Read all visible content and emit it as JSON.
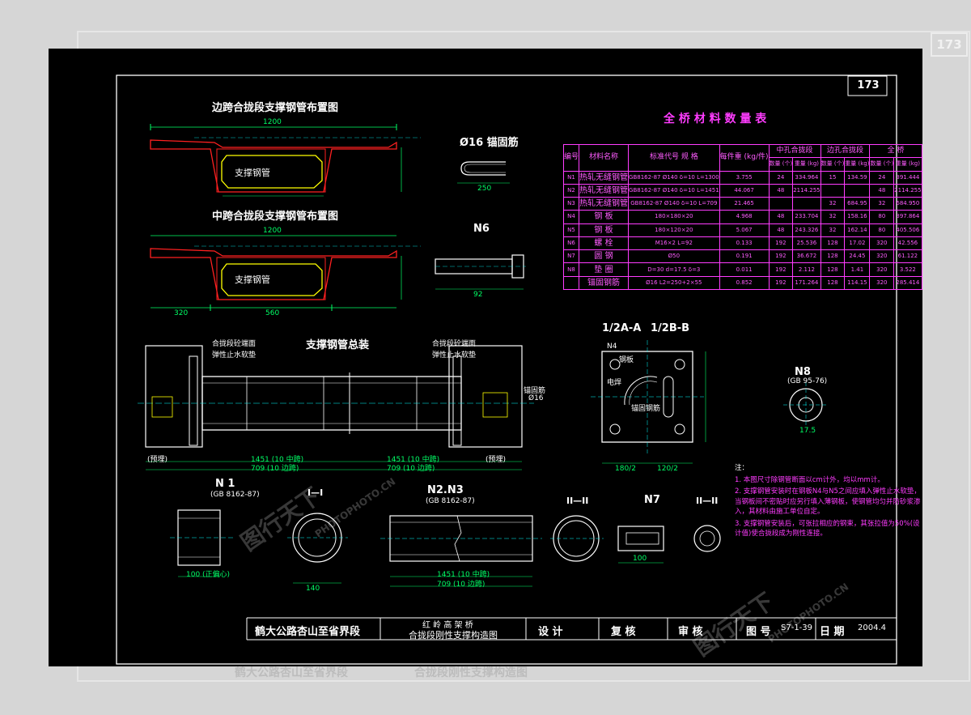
{
  "sheet_number": "173",
  "titles": {
    "side_span": "边跨合拢段支撑钢管布置图",
    "mid_span": "中跨合拢段支撑钢管布置图",
    "anchor_bar": "Ø16 锚固筋",
    "n6": "N6",
    "assembly": "支撑钢管总装",
    "section_aa": "1/2A-A",
    "section_bb": "1/2B-B",
    "n8": "N8",
    "n8_std": "(GB 95-76)",
    "n1": "N 1",
    "n1_std": "(GB 8162-87)",
    "sec_1": "I—I",
    "n2n3": "N2.N3",
    "n2n3_std": "(GB 8162-87)",
    "sec_2": "II—II",
    "n7": "N7",
    "sec_2b": "II—II"
  },
  "labels": {
    "steel_pipe": "支撑钢管",
    "end_face_left": "合拢段砼端面",
    "waterstop_left": "弹性止水软垫",
    "end_face_right": "合拢段砼端面",
    "waterstop_right": "弹性止水软垫",
    "anchor": "锚固筋",
    "anchor_dia": "Ø16",
    "weld_left": "(预埋)",
    "weld_right": "(预埋)",
    "plate_label_1": "钢板",
    "plate_label_2": "锚固钢筋",
    "plate_label_3": "电焊",
    "plate_label_4": "N4"
  },
  "dims": {
    "top_1": "1200",
    "side_320": "320",
    "mid_560": "560",
    "mid_1200": "1200",
    "n6_len": "92",
    "anchor_len": "250",
    "asm_1": "1451 (10 中跨)",
    "asm_2": "709 (10 边跨)",
    "n1_len": "100 (正偏心)",
    "n1_140": "140",
    "n2_1": "1451 (10 中跨)",
    "n2_2": "709 (10 边跨)",
    "n7_len": "100",
    "n8_d": "17.5",
    "plate_180": "180/2",
    "plate_120": "120/2"
  },
  "material_table": {
    "title": "全 桥 材 料 数 量 表",
    "headers": {
      "no": "编号",
      "name": "材料名称",
      "spec": "标准代号 规 格",
      "unit_wt": "每件重 (kg/件)",
      "mid": "中孔合拢段",
      "side": "边孔合拢段",
      "total": "全 桥",
      "count": "数量 (个)",
      "weight": "重量 (kg)"
    },
    "rows": [
      {
        "no": "N1",
        "name": "热轧无缝钢管",
        "spec": "GB8162-87  Ø140 δ=10  L=1300",
        "uw": "3.755",
        "mc": "24",
        "mw": "334.964",
        "sc": "15",
        "sw": "134.59",
        "tc": "24",
        "tw": "391.444"
      },
      {
        "no": "N2",
        "name": "热轧无缝钢管",
        "spec": "GB8162-87  Ø140 δ=10  L=1451",
        "uw": "44.067",
        "mc": "48",
        "mw": "2114.255",
        "sc": "",
        "sw": "",
        "tc": "48",
        "tw": "2114.255"
      },
      {
        "no": "N3",
        "name": "热轧无缝钢管",
        "spec": "GB8162-87  Ø140 δ=10  L=709",
        "uw": "21.465",
        "mc": "",
        "mw": "",
        "sc": "32",
        "sw": "684.95",
        "tc": "32",
        "tw": "684.950"
      },
      {
        "no": "N4",
        "name": "钢 板",
        "spec": "180×180×20",
        "uw": "4.968",
        "mc": "48",
        "mw": "233.704",
        "sc": "32",
        "sw": "158.16",
        "tc": "80",
        "tw": "397.864"
      },
      {
        "no": "N5",
        "name": "钢 板",
        "spec": "180×120×20",
        "uw": "5.067",
        "mc": "48",
        "mw": "243.326",
        "sc": "32",
        "sw": "162.14",
        "tc": "80",
        "tw": "405.506"
      },
      {
        "no": "N6",
        "name": "螺 栓",
        "spec": "M16×2  L=92",
        "uw": "0.133",
        "mc": "192",
        "mw": "25.536",
        "sc": "128",
        "sw": "17.02",
        "tc": "320",
        "tw": "42.556"
      },
      {
        "no": "N7",
        "name": "圆 钢",
        "spec": "Ø50",
        "uw": "0.191",
        "mc": "192",
        "mw": "36.672",
        "sc": "128",
        "sw": "24.45",
        "tc": "320",
        "tw": "61.122"
      },
      {
        "no": "N8",
        "name": "垫 圈",
        "spec": "D=30 d=17.5 δ=3",
        "uw": "0.011",
        "mc": "192",
        "mw": "2.112",
        "sc": "128",
        "sw": "1.41",
        "tc": "320",
        "tw": "3.522"
      },
      {
        "no": "",
        "name": "锚固钢筋",
        "spec": "Ø16  L2=250+2×55",
        "uw": "0.852",
        "mc": "192",
        "mw": "171.264",
        "sc": "128",
        "sw": "114.15",
        "tc": "320",
        "tw": "285.414"
      }
    ]
  },
  "notes": {
    "heading": "注：",
    "items": [
      "1. 本图尺寸除钢管断面以cm计外，均以mm计。",
      "2. 支撑钢管安装时在钢板N4与N5之间应填入弹性止水软垫，当钢板间不密贴时应另行填入薄钢板，使钢管均匀并防砂浆渗入，其材料由施工单位自定。",
      "3. 支撑钢管安装后，可张拉相应的钢束，其张拉值为50%(设计值)使合拢段成为刚性连接。"
    ]
  },
  "title_block": {
    "project": "鹤大公路杏山至省界段",
    "bridge": "红 岭 高 架 桥",
    "drawing": "合拢段刚性支撑构造图",
    "design": "设 计",
    "check": "复 核",
    "review": "审 核",
    "fig_label": "图 号",
    "fig_no": "S7-1-39",
    "date_label": "日 期",
    "date": "2004.4"
  },
  "watermark": {
    "brand": "图行天下",
    "site": "PHOTOPHOTO.CN"
  },
  "colors": {
    "background": "#000000",
    "line_white": "#ffffff",
    "concrete_red": "#ff2020",
    "pipe_yellow": "#ffff00",
    "dimension_green": "#00ff66",
    "table_magenta": "#ff3cff",
    "center_cyan": "#00ffff"
  }
}
